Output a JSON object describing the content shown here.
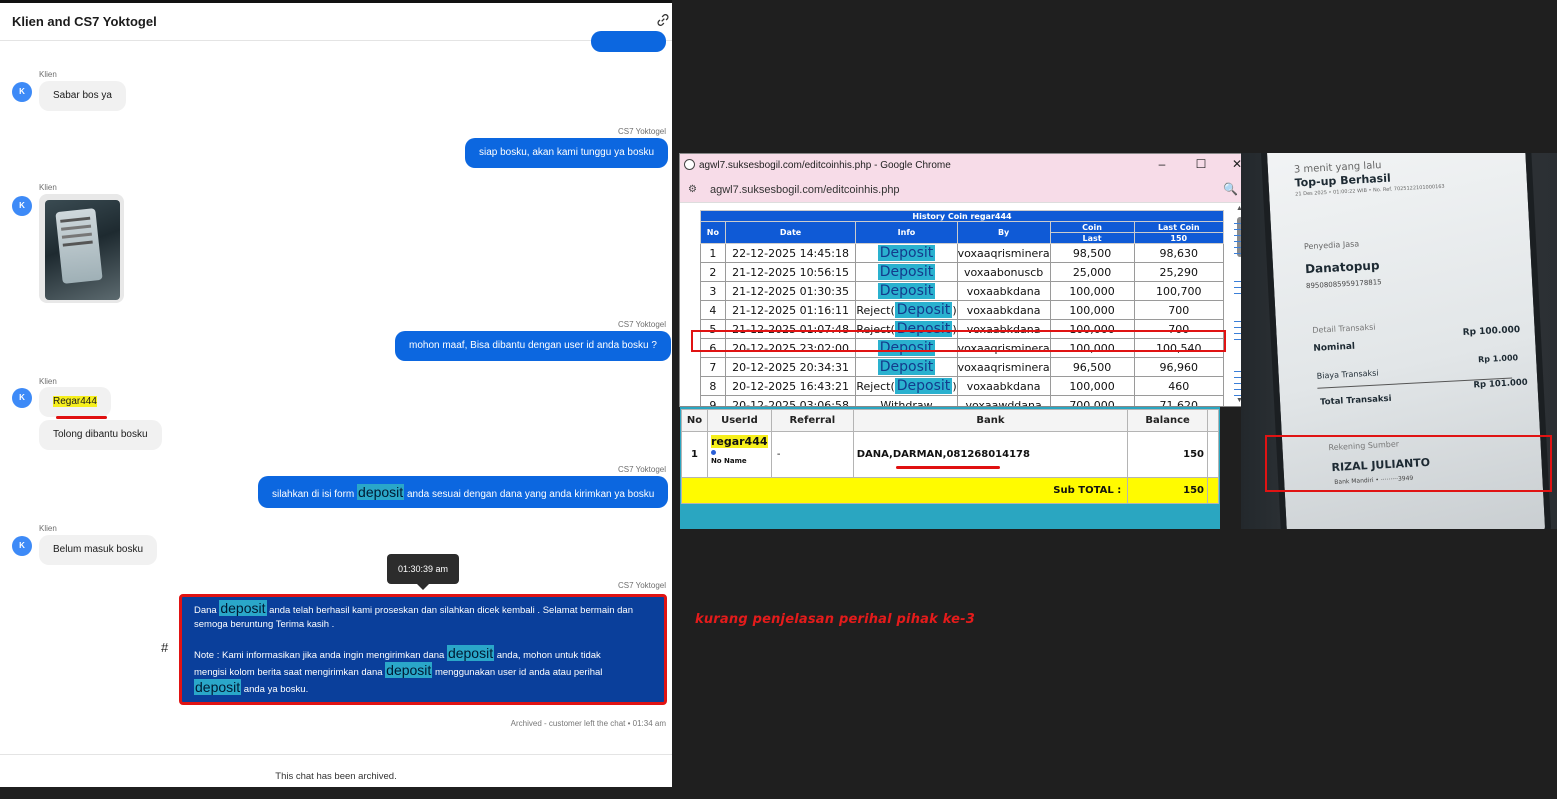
{
  "chat": {
    "title": "Klien and CS7 Yoktogel",
    "avatar_letter": "K",
    "messages": [
      {
        "sender": "Klien",
        "text": "Sabar bos ya"
      },
      {
        "sender": "CS7 Yoktogel",
        "text": "siap bosku, akan kami tunggu ya bosku"
      },
      {
        "sender": "Klien",
        "text": ""
      },
      {
        "sender": "CS7 Yoktogel",
        "text": "mohon maaf, Bisa dibantu dengan user id anda bosku ?"
      },
      {
        "sender": "Klien",
        "text": "Regar444"
      },
      {
        "sender": "Klien",
        "text": "Tolong dibantu bosku"
      },
      {
        "sender": "CS7 Yoktogel",
        "pre": "silahkan di isi form ",
        "hl": "deposit",
        "post": " anda sesuai dengan dana yang anda kirimkan ya bosku"
      },
      {
        "sender": "Klien",
        "text": "Belum masuk bosku"
      },
      {
        "sender": "CS7 Yoktogel"
      }
    ],
    "tooltip_time": "01:30:39 am",
    "big_message": {
      "l1_a": "Dana ",
      "hl": "deposit",
      "l1_b": " anda telah berhasil kami proseskan dan silahkan dicek kembali . Selamat bermain dan",
      "l2": "semoga beruntung Terima kasih .",
      "l3_a": "Note : Kami informasikan jika anda ingin mengirimkan dana ",
      "l3_b": " anda, mohon untuk tidak",
      "l4_a": "mengisi kolom berita saat mengirimkan dana ",
      "l4_b": " menggunakan user id anda atau perihal",
      "l5_b": " anda ya bosku."
    },
    "hash": "#",
    "archive_note": "Archived - customer left the chat • 01:34 am",
    "footer": "This chat has been archived."
  },
  "browser": {
    "window_title": "agwl7.suksesbogil.com/editcoinhis.php - Google Chrome",
    "url": "agwl7.suksesbogil.com/editcoinhis.php",
    "minimize": "–",
    "maximize": "☐",
    "close": "✕",
    "table_title": "History Coin regar444",
    "headers": [
      "No",
      "Date",
      "Info",
      "By",
      "Coin",
      "Last Coin"
    ],
    "subheaders": [
      "Last",
      "150"
    ],
    "rows": [
      {
        "no": "1",
        "date": "22-12-2025 14:45:18",
        "pre": "",
        "info": "Deposit",
        "post": "",
        "by": "voxaaqrisminera",
        "coin": "98,500",
        "last": "98,630"
      },
      {
        "no": "2",
        "date": "21-12-2025 10:56:15",
        "pre": "",
        "info": "Deposit",
        "post": "",
        "by": "voxaabonuscb",
        "coin": "25,000",
        "last": "25,290"
      },
      {
        "no": "3",
        "date": "21-12-2025 01:30:35",
        "pre": "",
        "info": "Deposit",
        "post": "",
        "by": "voxaabkdana",
        "coin": "100,000",
        "last": "100,700"
      },
      {
        "no": "4",
        "date": "21-12-2025 01:16:11",
        "pre": "Reject(",
        "info": "Deposit",
        "post": ")",
        "by": "voxaabkdana",
        "coin": "100,000",
        "last": "700"
      },
      {
        "no": "5",
        "date": "21-12-2025 01:07:48",
        "pre": "Reject(",
        "info": "Deposit",
        "post": ")",
        "by": "voxaabkdana",
        "coin": "100,000",
        "last": "700"
      },
      {
        "no": "6",
        "date": "20-12-2025 23:02:00",
        "pre": "",
        "info": "Deposit",
        "post": "",
        "by": "voxaaqrisminera",
        "coin": "100,000",
        "last": "100,540"
      },
      {
        "no": "7",
        "date": "20-12-2025 20:34:31",
        "pre": "",
        "info": "Deposit",
        "post": "",
        "by": "voxaaqrisminera",
        "coin": "96,500",
        "last": "96,960"
      },
      {
        "no": "8",
        "date": "20-12-2025 16:43:21",
        "pre": "Reject(",
        "info": "Deposit",
        "post": ")",
        "by": "voxaabkdana",
        "coin": "100,000",
        "last": "460"
      },
      {
        "no": "9",
        "date": "20-12-2025 03:06:58",
        "pre": "",
        "info": "Withdraw",
        "post": "",
        "by": "voxaawddana",
        "coin": "700,000",
        "last": "71,620"
      }
    ]
  },
  "balance_table": {
    "headers": [
      "No",
      "UserId",
      "Referral",
      "Bank",
      "Balance"
    ],
    "row": {
      "no": "1",
      "userid": "regar444",
      "noname": "No Name",
      "referral": "-",
      "bank": "DANA,DARMAN,081268014178",
      "balance": "150"
    },
    "subtotal_label": "Sub TOTAL :",
    "subtotal_value": "150"
  },
  "phone": {
    "time_ago": "3 menit yang lalu",
    "status": "Top-up Berhasil",
    "datetime": "21 Des 2025 • 01:00:22 WIB • No. Ref. 7025122101000163",
    "provider_label": "Penyedia Jasa",
    "provider": "Danatopup",
    "provider_no": "89508085959178815",
    "detail_label": "Detail Transaksi",
    "nominal_label": "Nominal",
    "nominal": "Rp 100.000",
    "fee_label": "Biaya Transaksi",
    "fee": "Rp 1.000",
    "total_label": "Total Transaksi",
    "total": "Rp 101.000",
    "source_label": "Rekening Sumber",
    "source_name": "RIZAL JULIANTO",
    "source_bank": "Bank Mandiri • ·········3949"
  },
  "caption": "kurang penjelasan perihal pihak ke-3",
  "colors": {
    "accent_blue": "#0c67e0",
    "highlight_red": "#e01313",
    "deposit_highlight": "#2aa7c9"
  }
}
